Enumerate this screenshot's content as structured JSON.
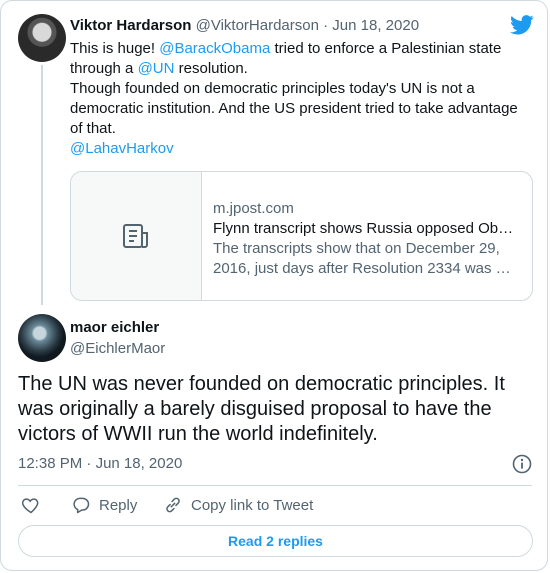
{
  "tweet_quoted": {
    "author_name": "Viktor Hardarson",
    "author_handle": "@ViktorHardarson",
    "separator": "·",
    "date": "Jun 18, 2020",
    "line1_pre": "This is huge! ",
    "mention1": "@BarackObama",
    "line1_post": " tried to enforce a Palestinian state",
    "line2_pre": "through a ",
    "mention2": "@UN",
    "line2_post": " resolution.",
    "line3": "Though founded on democratic principles today's UN is not a",
    "line4": "democratic institution. And the US president tried to take advantage",
    "line5": "of that.",
    "mention3": "@LahavHarkov"
  },
  "link_preview": {
    "domain": "m.jpost.com",
    "title": "Flynn transcript shows Russia opposed Ob…",
    "desc_line1": "The transcripts show that on December 29,",
    "desc_line2": "2016, just days after Resolution 2334 was …"
  },
  "tweet_main": {
    "author_name": "maor eichler",
    "author_handle": "@EichlerMaor",
    "text_line1": "The UN was never founded on democratic principles. It",
    "text_line2": "was originally a barely disguised proposal to have the",
    "text_line3": "victors of WWII run the world indefinitely.",
    "time": "12:38 PM",
    "separator": "·",
    "date": "Jun 18, 2020"
  },
  "actions": {
    "reply": "Reply",
    "copy_link": "Copy link to Tweet",
    "read_replies": "Read 2 replies"
  },
  "colors": {
    "accent": "#1d9bf0",
    "muted": "#536471",
    "border": "#cfd9de"
  },
  "icons": [
    "twitter-bird-icon",
    "article-icon",
    "info-icon",
    "heart-icon",
    "reply-icon",
    "link-icon"
  ]
}
